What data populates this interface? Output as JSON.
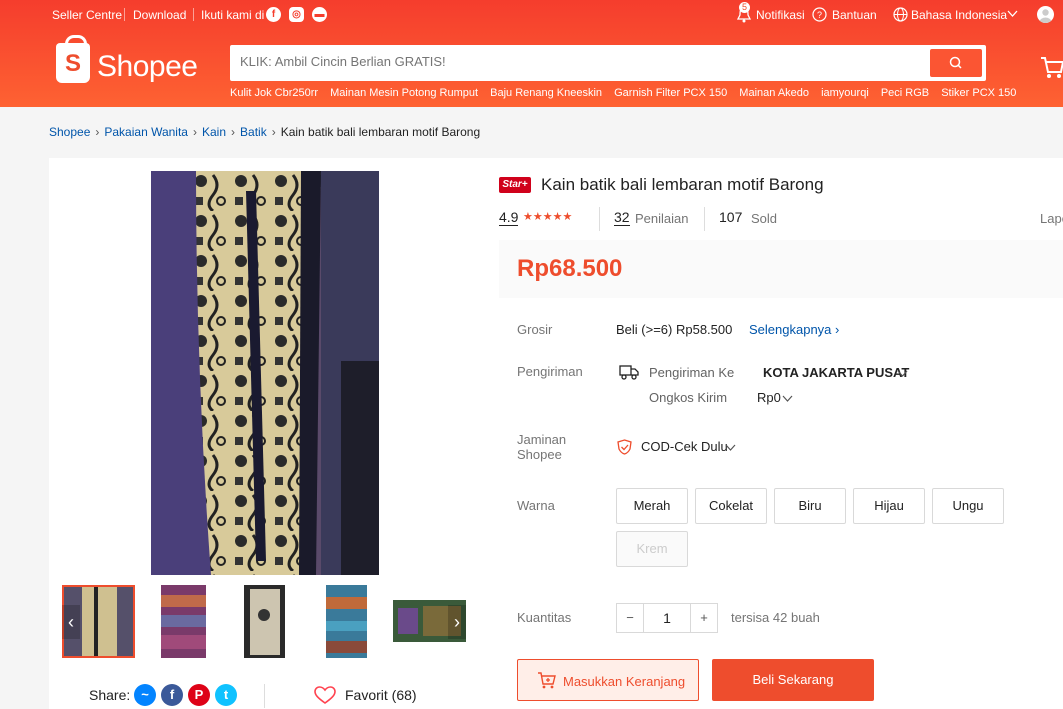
{
  "topbar": {
    "seller_centre": "Seller Centre",
    "download": "Download",
    "follow": "Ikuti kami di",
    "notif_count": "5",
    "notifications": "Notifikasi",
    "help": "Bantuan",
    "language": "Bahasa Indonesia"
  },
  "header": {
    "logo_text": "Shopee",
    "search_placeholder": "KLIK: Ambil Cincin Berlian GRATIS!",
    "hints": [
      "Kulit Jok Cbr250rr",
      "Mainan Mesin Potong Rumput",
      "Baju Renang Kneeskin",
      "Garnish Filter PCX 150",
      "Mainan Akedo",
      "iamyourqi",
      "Peci RGB",
      "Stiker PCX 150"
    ]
  },
  "breadcrumb": [
    "Shopee",
    "Pakaian Wanita",
    "Kain",
    "Batik"
  ],
  "breadcrumb_current": "Kain batik bali lembaran motif Barong",
  "product": {
    "badge": "Star+",
    "title": "Kain batik bali lembaran motif Barong",
    "rating": "4.9",
    "stars": "★★★★★",
    "reviews_count": "32",
    "reviews_label": "Penilaian",
    "sold_count": "107",
    "sold_label": "Sold",
    "report": "Lapor",
    "price": "Rp68.500"
  },
  "details": {
    "grosir_label": "Grosir",
    "grosir_value": "Beli (>=6) Rp58.500",
    "more_link": "Selengkapnya",
    "shipping_label": "Pengiriman",
    "ship_to_label": "Pengiriman Ke",
    "ship_to_value": "KOTA JAKARTA PUSAT",
    "ship_cost_label": "Ongkos Kirim",
    "ship_cost_value": "Rp0",
    "guarantee_label_1": "Jaminan",
    "guarantee_label_2": "Shopee",
    "guarantee_value": "COD-Cek Dulu",
    "color_label": "Warna",
    "colors": [
      "Merah",
      "Cokelat",
      "Biru",
      "Hijau",
      "Ungu",
      "Krem"
    ],
    "qty_label": "Kuantitas",
    "qty_value": "1",
    "stock": "tersisa 42 buah"
  },
  "actions": {
    "add_to_cart": "Masukkan Keranjang",
    "buy_now": "Beli Sekarang"
  },
  "social": {
    "share": "Share:",
    "favorite": "Favorit (68)"
  },
  "colors": {
    "brand": "#ee4d2d",
    "link": "#0055aa"
  }
}
